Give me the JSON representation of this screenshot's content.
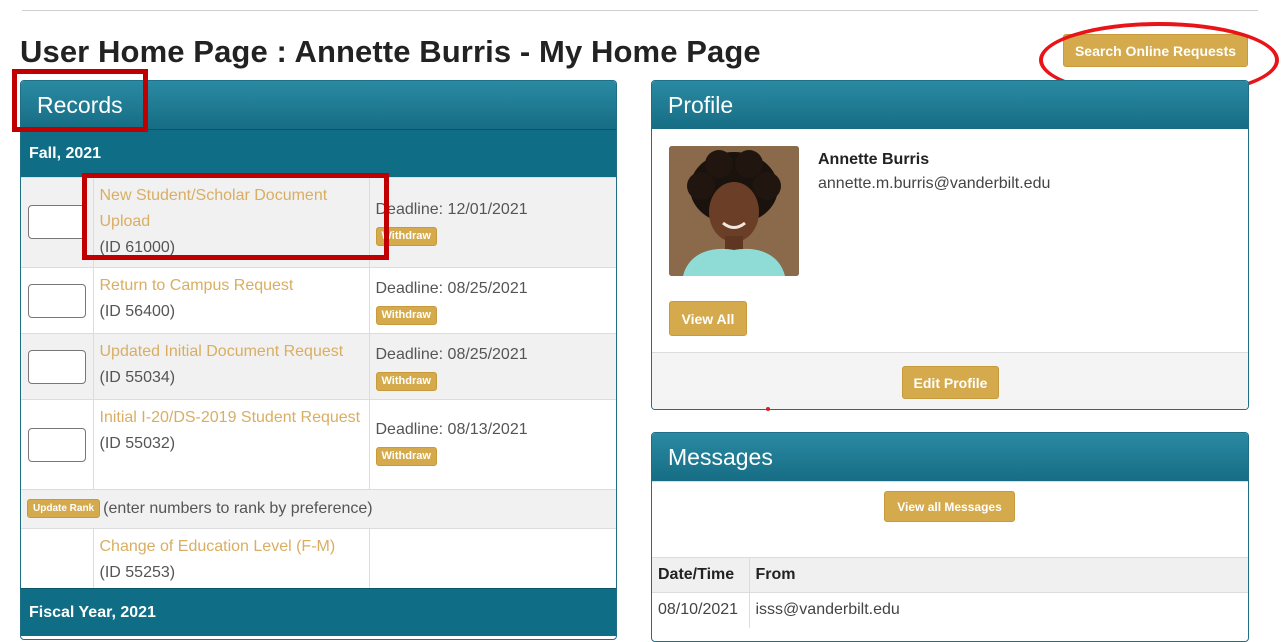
{
  "page": {
    "title": "User Home Page : Annette Burris - My Home Page",
    "search_button": "Search Online Requests"
  },
  "records": {
    "heading": "Records",
    "sections": [
      {
        "name": "Fall, 2021",
        "items": [
          {
            "title": "New Student/Scholar Document Upload",
            "id": "(ID 61000)",
            "deadline": "Deadline: 12/01/2021",
            "action": "Withdraw"
          },
          {
            "title": "Return to Campus Request",
            "id": "(ID 56400)",
            "deadline": "Deadline: 08/25/2021",
            "action": "Withdraw"
          },
          {
            "title": "Updated Initial Document Request",
            "id": "(ID 55034)",
            "deadline": "Deadline: 08/25/2021",
            "action": "Withdraw"
          },
          {
            "title": "Initial I-20/DS-2019 Student Request",
            "id": "(ID 55032)",
            "deadline": "Deadline: 08/13/2021",
            "action": "Withdraw"
          }
        ],
        "rank_button": "Update Rank",
        "rank_hint": "(enter numbers to rank by preference)",
        "extra_item": {
          "title": "Change of Education Level (F-M)",
          "id": "(ID 55253)"
        }
      },
      {
        "name": "Fiscal Year, 2021"
      }
    ]
  },
  "profile": {
    "heading": "Profile",
    "name": "Annette Burris",
    "email": "annette.m.burris@vanderbilt.edu",
    "view_all": "View All",
    "edit": "Edit Profile"
  },
  "messages": {
    "heading": "Messages",
    "view_all": "View all Messages",
    "columns": [
      "Date/Time",
      "From"
    ],
    "rows": [
      {
        "date": "08/10/2021",
        "from": "isss@vanderbilt.edu"
      }
    ]
  },
  "colors": {
    "accent_gold": "#d4aa4d",
    "panel_teal": "#106d86",
    "link_tan": "#d9ae63",
    "annotation_red": "#c00000"
  }
}
